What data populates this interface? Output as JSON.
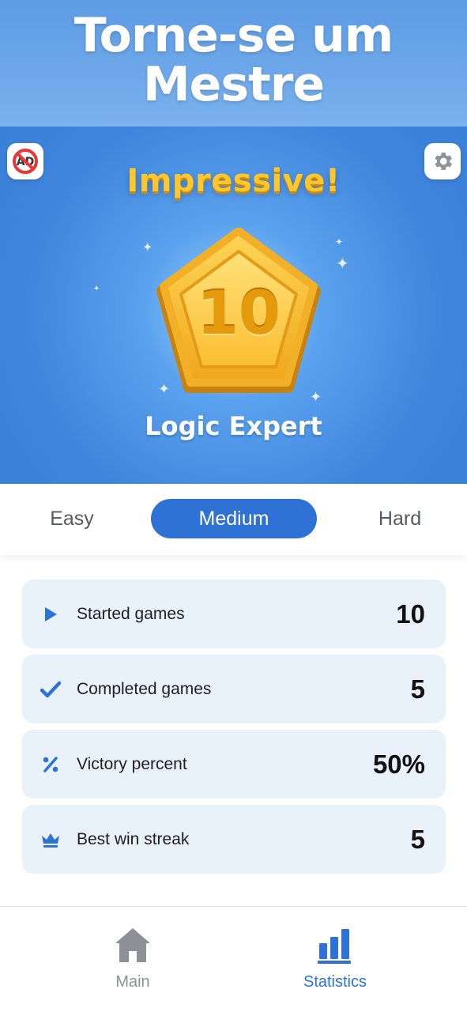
{
  "promo": {
    "title": "Torne-se um Mestre"
  },
  "hero": {
    "headline": "Impressive!",
    "level": "10",
    "rank_title": "Logic Expert",
    "left_button_icon": "no-ads-icon",
    "right_button_icon": "gear-icon"
  },
  "difficulty_tabs": [
    {
      "label": "Easy",
      "selected": false
    },
    {
      "label": "Medium",
      "selected": true
    },
    {
      "label": "Hard",
      "selected": false
    }
  ],
  "stats": [
    {
      "icon": "play-icon",
      "label": "Started games",
      "value": "10"
    },
    {
      "icon": "checkmark-icon",
      "label": "Completed games",
      "value": "5"
    },
    {
      "icon": "percent-icon",
      "label": "Victory percent",
      "value": "50%"
    },
    {
      "icon": "crown-icon",
      "label": "Best win streak",
      "value": "5"
    }
  ],
  "bottom_nav": [
    {
      "icon": "home-icon",
      "label": "Main",
      "active": false
    },
    {
      "icon": "bar-chart-icon",
      "label": "Statistics",
      "active": true
    }
  ],
  "colors": {
    "accent": "#2f72d6",
    "badge_gold": "#ffc72c",
    "stat_row_bg": "#e9f1fb",
    "hero_blue": "#3f85dd",
    "inactive_gray": "#8d9096"
  }
}
